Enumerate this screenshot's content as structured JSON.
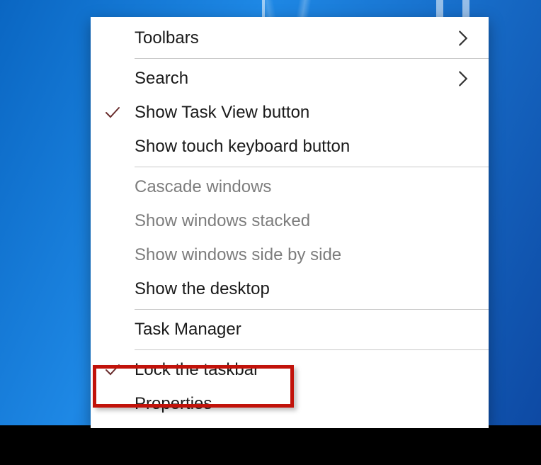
{
  "menu": {
    "items": {
      "toolbars": {
        "label": "Toolbars",
        "checked": false,
        "submenu": true,
        "disabled": false
      },
      "search": {
        "label": "Search",
        "checked": false,
        "submenu": true,
        "disabled": false
      },
      "show_task_view": {
        "label": "Show Task View button",
        "checked": true,
        "submenu": false,
        "disabled": false
      },
      "show_touch_keyboard": {
        "label": "Show touch keyboard button",
        "checked": false,
        "submenu": false,
        "disabled": false
      },
      "cascade_windows": {
        "label": "Cascade windows",
        "checked": false,
        "submenu": false,
        "disabled": true
      },
      "show_windows_stacked": {
        "label": "Show windows stacked",
        "checked": false,
        "submenu": false,
        "disabled": true
      },
      "show_windows_sbs": {
        "label": "Show windows side by side",
        "checked": false,
        "submenu": false,
        "disabled": true
      },
      "show_the_desktop": {
        "label": "Show the desktop",
        "checked": false,
        "submenu": false,
        "disabled": false
      },
      "task_manager": {
        "label": "Task Manager",
        "checked": false,
        "submenu": false,
        "disabled": false
      },
      "lock_the_taskbar": {
        "label": "Lock the taskbar",
        "checked": true,
        "submenu": false,
        "disabled": false
      },
      "properties": {
        "label": "Properties",
        "checked": false,
        "submenu": false,
        "disabled": false
      }
    }
  },
  "annotation": {
    "highlighted_item": "lock_the_taskbar",
    "highlight_color": "#c1120a"
  }
}
